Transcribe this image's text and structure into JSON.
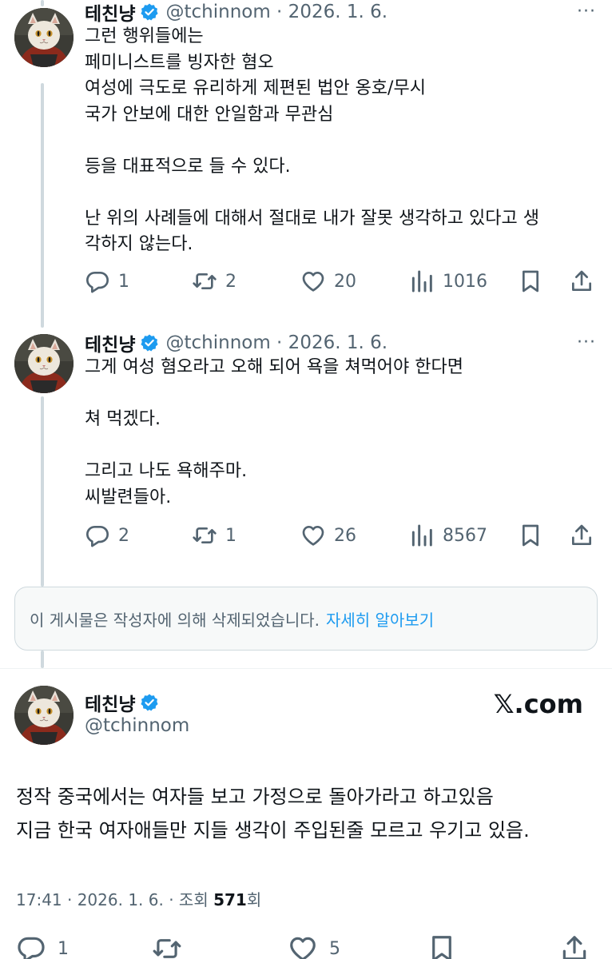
{
  "tweets": [
    {
      "name": "테친냥",
      "handle": "@tchinnom · 2026. 1. 6.",
      "more": "···",
      "text": "그런 행위들에는\n페미니스트를 빙자한 혐오\n여성에 극도로 유리하게 제편된 법안 옹호/무시\n국가 안보에 대한 안일함과 무관심\n\n등을 대표적으로 들 수 있다.\n\n난 위의 사례들에 대해서 절대로 내가 잘못 생각하고 있다고 생\n각하지 않는다.",
      "replies": "1",
      "retweets": "2",
      "likes": "20",
      "views": "1016"
    },
    {
      "name": "테친냥",
      "handle": "@tchinnom · 2026. 1. 6.",
      "more": "···",
      "text": "그게 여성 혐오라고 오해 되어 욕을 쳐먹어야 한다면\n\n쳐 먹겠다.\n\n그리고 나도 욕해주마.\n씨발련들아.",
      "replies": "2",
      "retweets": "1",
      "likes": "26",
      "views": "8567"
    }
  ],
  "deleted_notice": {
    "text": "이 게시물은 작성자에 의해 삭제되었습니다.",
    "link": "자세히 알아보기"
  },
  "main_tweet": {
    "name": "테친냥",
    "handle": "@tchinnom",
    "brand": "𝕏.com",
    "line1": "정작 중국에서는 여자들 보고 가정으로 돌아가라고 하고있음",
    "line2": "지금 한국 여자애들만 지들 생각이 주입된줄 모르고 우기고 있음.",
    "time": "17:41 · 2026. 1. 6. · 조회 ",
    "view_count": "571",
    "view_suffix": "회",
    "replies": "1",
    "likes": "5"
  },
  "colors": {
    "accent": "#1d9bf0",
    "text": "#0f1419",
    "muted": "#536471",
    "border": "#cfd9de"
  },
  "icons": [
    "reply-icon",
    "retweet-icon",
    "like-icon",
    "views-icon",
    "bookmark-icon",
    "share-icon",
    "verified-badge-icon",
    "more-icon"
  ]
}
